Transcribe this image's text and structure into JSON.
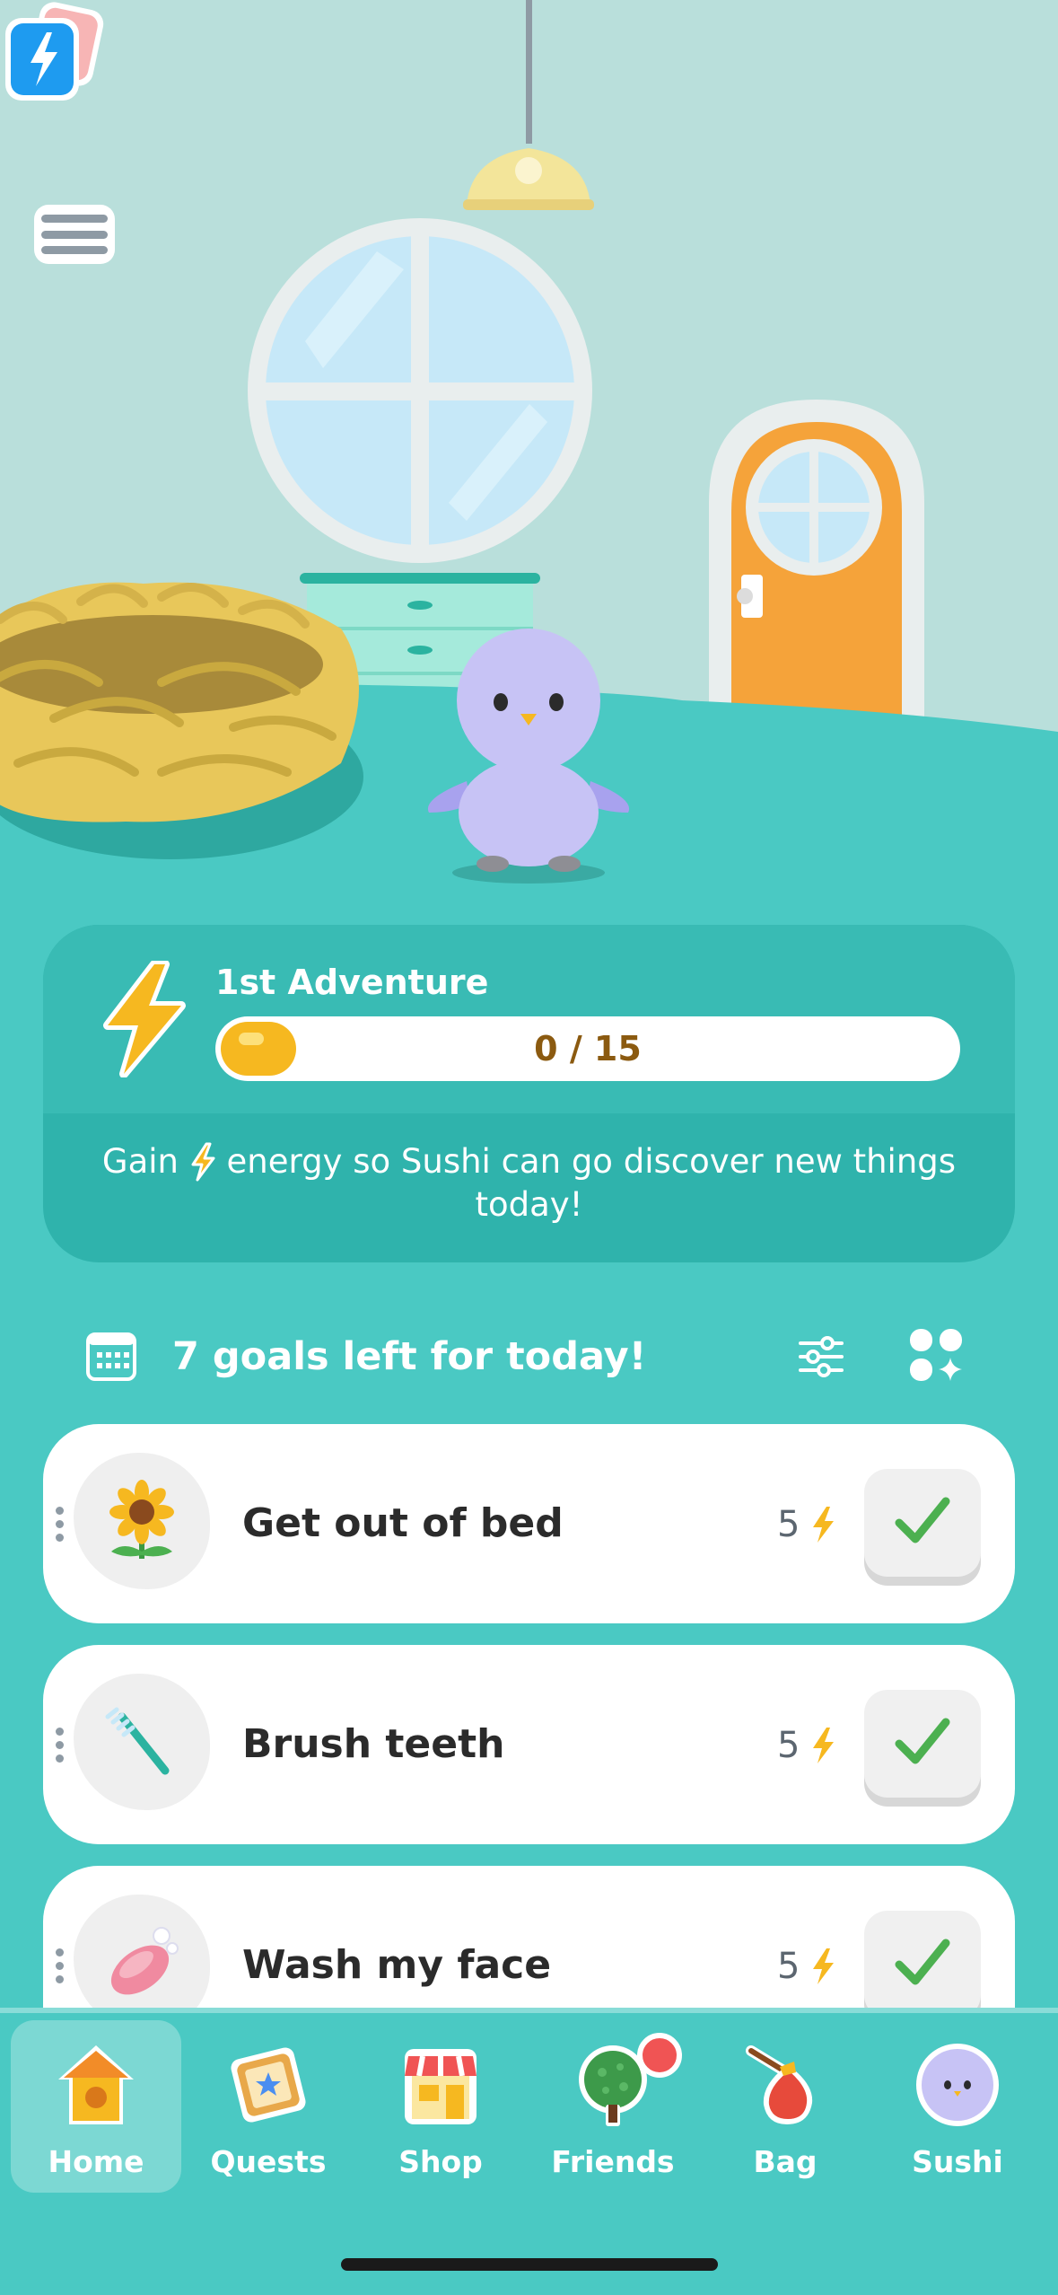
{
  "adventure": {
    "title": "1st Adventure",
    "progress_current": 0,
    "progress_total": 15,
    "progress_text": "0 / 15",
    "desc_before": "Gain",
    "desc_after": "energy so Sushi can go discover new things today!"
  },
  "goals": {
    "header": "7 goals left for today!",
    "items": [
      {
        "label": "Get out of bed",
        "energy": "5",
        "icon": "sunflower-icon"
      },
      {
        "label": "Brush teeth",
        "energy": "5",
        "icon": "toothbrush-icon"
      },
      {
        "label": "Wash my face",
        "energy": "5",
        "icon": "soap-icon"
      }
    ]
  },
  "tabs": [
    {
      "label": "Home",
      "icon": "birdhouse-icon",
      "active": true
    },
    {
      "label": "Quests",
      "icon": "quest-scroll-icon"
    },
    {
      "label": "Shop",
      "icon": "shop-icon"
    },
    {
      "label": "Friends",
      "icon": "tree-icon",
      "badge": true
    },
    {
      "label": "Bag",
      "icon": "bag-icon"
    },
    {
      "label": "Sushi",
      "icon": "sushi-avatar-icon"
    }
  ],
  "colors": {
    "background": "#4ac9c3",
    "card": "#39bbb4",
    "energy": "#f6b820",
    "check": "#4cb050",
    "door": "#f5a33a",
    "bird": "#c7c3f5"
  }
}
